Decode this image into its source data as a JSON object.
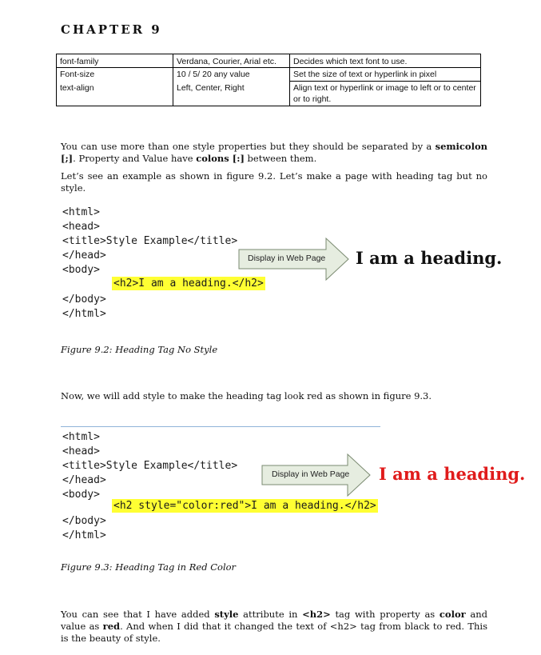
{
  "chapter": "CHAPTER 9",
  "table": {
    "rows": [
      [
        "font-family",
        "Verdana, Courier, Arial etc.",
        "Decides which text font to use."
      ],
      [
        "Font-size",
        "10 / 5/ 20 any value",
        "Set the size of text or hyperlink in pixel"
      ],
      [
        "text-align",
        "Left, Center, Right",
        "Align text or hyperlink or image to left or to center or to right."
      ]
    ]
  },
  "para1": {
    "a": "You can use more than one style properties but they should be separated by a ",
    "b": "semicolon [;]",
    "c": ". Property and Value have ",
    "d": "colons [:]",
    "e": " between them."
  },
  "para2": "Let’s see an example as shown in figure 9.2. Let’s make a page with heading tag but no style.",
  "example1": {
    "lines": [
      "<html>",
      "<head>",
      "<title>Style Example</title>",
      "</head>",
      "<body>"
    ],
    "highlight": "<h2>I am a heading.</h2>",
    "end_lines": [
      "</body>",
      "</html>"
    ],
    "arrow_label": "Display in Web Page",
    "output": "I am a heading.",
    "output_color": "#111111"
  },
  "caption1": "Figure 9.2: Heading Tag No Style",
  "para3": "Now, we will add style to make the heading tag look red as shown in figure 9.3.",
  "example2": {
    "lines": [
      "<html>",
      "<head>",
      "<title>Style Example</title>",
      "</head>",
      "<body>"
    ],
    "highlight": "<h2 style=\"color:red\">I am a heading.</h2>",
    "end_lines": [
      "</body>",
      "</html>"
    ],
    "arrow_label": "Display in Web Page",
    "output": "I am a heading.",
    "output_color": "#e01b1b"
  },
  "caption2": "Figure 9.3: Heading Tag in Red Color",
  "para4": {
    "a": "You can see that I have added ",
    "b": "style",
    "c": " attribute in ",
    "d": "<h2>",
    "e": " tag with property as ",
    "f": "color",
    "g": " and value as ",
    "h": "red",
    "i": ". And when I did that it changed the text of <h2> tag from black to red. This is the beauty of style."
  },
  "colors": {
    "highlight": "#ffff33",
    "arrow_fill": "#e6ede0",
    "arrow_stroke": "#7a8a70",
    "divider": "#8fb3d9"
  }
}
